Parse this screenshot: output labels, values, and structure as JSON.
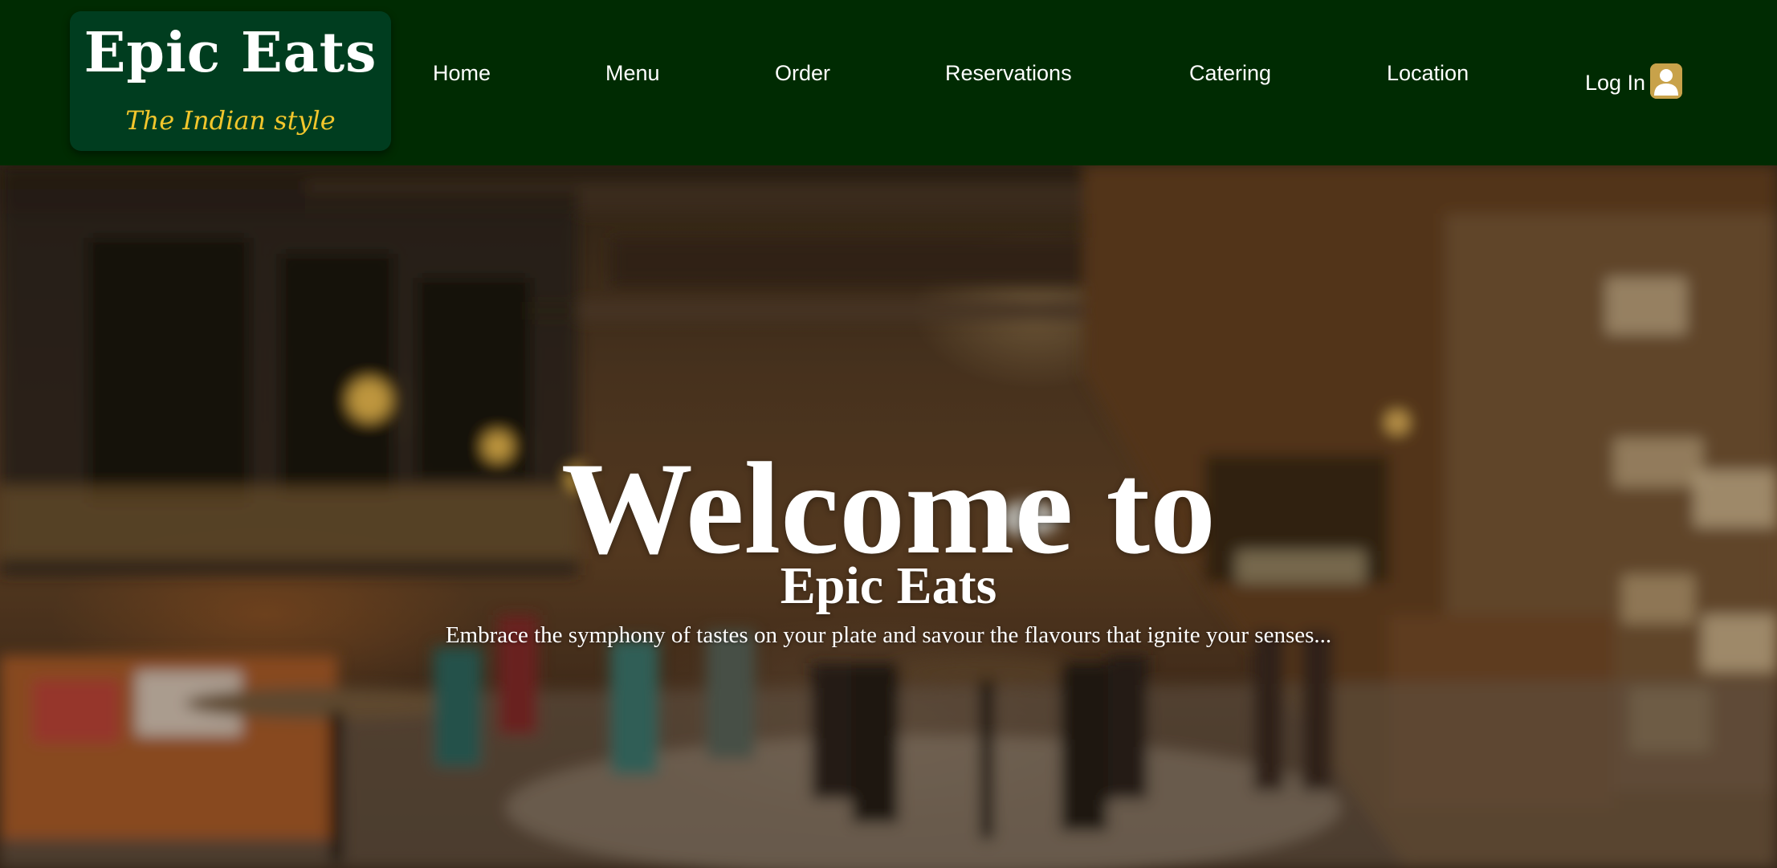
{
  "header": {
    "logo": {
      "title": "Epic Eats",
      "tagline": "The Indian style"
    },
    "nav": {
      "home": "Home",
      "menu": "Menu",
      "order": "Order",
      "reservations": "Reservations",
      "catering": "Catering",
      "location": "Location"
    },
    "login": {
      "label": "Log In",
      "icon": "user-icon"
    }
  },
  "hero": {
    "title": "Welcome to",
    "subtitle": "Epic Eats",
    "tagline": "Embrace the symphony of tastes on your plate and savour the flavours that ignite your senses..."
  },
  "colors": {
    "header_bg": "#002b02",
    "logo_bg": "#003d1f",
    "logo_tagline": "#f2c62c",
    "login_icon_bg": "#c8a24a",
    "text": "#ffffff"
  }
}
